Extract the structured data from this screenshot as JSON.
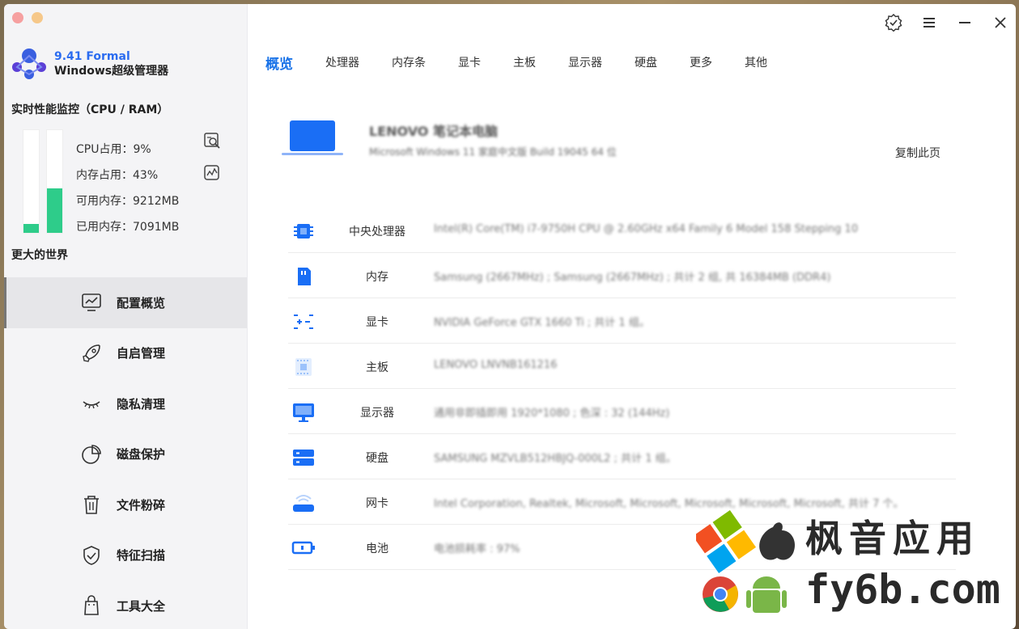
{
  "app": {
    "version": "9.41 Formal",
    "name": "Windows超级管理器"
  },
  "monitor": {
    "title": "实时性能监控（CPU / RAM）",
    "cpu_usage": "CPU占用：9%",
    "mem_usage": "内存占用：43%",
    "mem_available": "可用内存：9212MB",
    "mem_used": "已用内存：7091MB",
    "cpu_fraction": 0.09,
    "mem_fraction": 0.43
  },
  "sidebar": {
    "section_title": "更大的世界",
    "items": [
      {
        "label": "配置概览",
        "icon": "monitor-chart-icon"
      },
      {
        "label": "自启管理",
        "icon": "rocket-icon"
      },
      {
        "label": "隐私清理",
        "icon": "closed-eye-icon"
      },
      {
        "label": "磁盘保护",
        "icon": "pie-chart-icon"
      },
      {
        "label": "文件粉碎",
        "icon": "trash-icon"
      },
      {
        "label": "特征扫描",
        "icon": "shield-check-icon"
      },
      {
        "label": "工具大全",
        "icon": "bag-icon"
      }
    ]
  },
  "tabs": [
    "概览",
    "处理器",
    "内存条",
    "显卡",
    "主板",
    "显示器",
    "硬盘",
    "更多",
    "其他"
  ],
  "device": {
    "name": "LENOVO 笔记本电脑",
    "os": "Microsoft Windows 11 家庭中文版 Build 19045 64 位",
    "copy_label": "复制此页"
  },
  "specs": [
    {
      "label": "中央处理器",
      "value": "Intel(R) Core(TM) i7-9750H CPU @ 2.60GHz x64 Family 6 Model 158 Stepping 10"
    },
    {
      "label": "内存",
      "value": "Samsung (2667MHz) ; Samsung (2667MHz) ; 共计 2 组, 共 16384MB (DDR4)"
    },
    {
      "label": "显卡",
      "value": "NVIDIA GeForce GTX 1660 Ti ; 共计 1 组。"
    },
    {
      "label": "主板",
      "value": "LENOVO LNVNB161216"
    },
    {
      "label": "显示器",
      "value": "通用非即插即用 1920*1080 ; 色深 : 32 (144Hz)"
    },
    {
      "label": "硬盘",
      "value": "SAMSUNG MZVLB512HBJQ-000L2 ; 共计 1 组。"
    },
    {
      "label": "网卡",
      "value": "Intel Corporation, Realtek, Microsoft, Microsoft, Microsoft, Microsoft, Microsoft, 共计 7 个。"
    },
    {
      "label": "电池",
      "value": "电池损耗率 : 97%"
    }
  ],
  "watermark": {
    "line1": "枫音应用",
    "line2": "fy6b.com"
  },
  "colors": {
    "accent": "#1a73e8",
    "bar_fill": "#2ecc8a",
    "icon_blue": "#1a6ef5"
  }
}
